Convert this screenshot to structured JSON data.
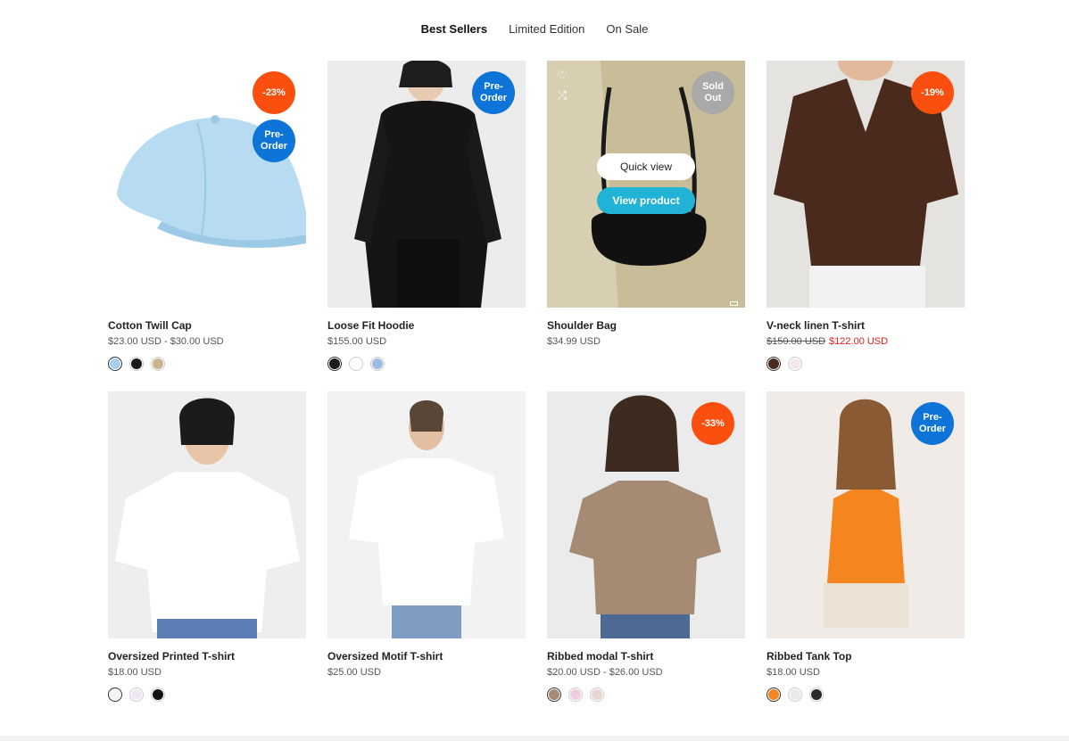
{
  "tabs": [
    {
      "label": "Best Sellers"
    },
    {
      "label": "Limited Edition"
    },
    {
      "label": "On Sale"
    }
  ],
  "products": [
    {
      "title": "Cotton Twill Cap",
      "price": "$23.00 USD - $30.00 USD",
      "badges": [
        "-23%",
        "Pre-Order"
      ],
      "swatches": [
        "#a7d0ea",
        "#1b1b1b",
        "#c9b38d"
      ]
    },
    {
      "title": "Loose Fit Hoodie",
      "price": "$155.00 USD",
      "badges": [
        "Pre-Order"
      ],
      "swatches": [
        "#1a1a1a",
        "#ffffff",
        "#9ebde2"
      ]
    },
    {
      "title": "Shoulder Bag",
      "price": "$34.99 USD",
      "badges": [
        "Sold Out"
      ],
      "quick_view": "Quick view",
      "view_product": "View product",
      "swatches": []
    },
    {
      "title": "V-neck linen T-shirt",
      "price_old": "$150.00 USD",
      "price_new": "$122.00 USD",
      "badges": [
        "-19%"
      ],
      "swatches": [
        "#4a2a1c",
        "#f4e9e6"
      ]
    },
    {
      "title": "Oversized Printed T-shirt",
      "price": "$18.00 USD",
      "badges": [],
      "swatches": [
        "#f4f4f4",
        "#f2e8f5",
        "#141414"
      ]
    },
    {
      "title": "Oversized Motif T-shirt",
      "price": "$25.00 USD",
      "badges": [],
      "swatches": []
    },
    {
      "title": "Ribbed modal T-shirt",
      "price": "$20.00 USD - $26.00 USD",
      "badges": [
        "-33%"
      ],
      "swatches": [
        "#a58a74",
        "#f0cce0",
        "#e8d7cf"
      ]
    },
    {
      "title": "Ribbed Tank Top",
      "price": "$18.00 USD",
      "badges": [
        "Pre-Order"
      ],
      "swatches": [
        "#f5861f",
        "#eaeaea",
        "#2a2a2a"
      ]
    }
  ],
  "colors": {
    "sale_badge": "#fa4f0f",
    "preorder_badge": "#0e74d8",
    "soldout_badge": "#a9a9a9",
    "view_button": "#21b3d6",
    "sale_price": "#e31b1b"
  }
}
